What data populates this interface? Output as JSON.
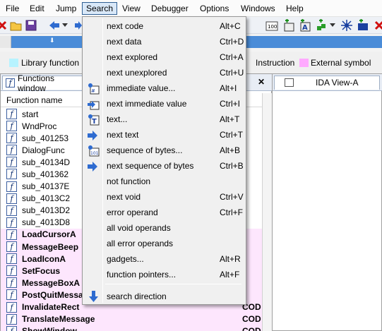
{
  "menubar": {
    "items": [
      "File",
      "Edit",
      "Jump",
      "Search",
      "View",
      "Debugger",
      "Options",
      "Windows",
      "Help"
    ],
    "active": "Search"
  },
  "legend": {
    "items": [
      {
        "label": "Library function",
        "color": "#b7f3ff"
      },
      {
        "label": "Instruction",
        "color": ""
      },
      {
        "label": "External symbol",
        "color": "#ffaaff"
      }
    ]
  },
  "functions_window": {
    "tab_title": "Functions window",
    "column_header": "Function name",
    "rows": [
      {
        "name": "start",
        "library": false,
        "segment": ""
      },
      {
        "name": "WndProc",
        "library": false,
        "segment": ""
      },
      {
        "name": "sub_401253",
        "library": false,
        "segment": ""
      },
      {
        "name": "DialogFunc",
        "library": false,
        "segment": ""
      },
      {
        "name": "sub_40134D",
        "library": false,
        "segment": ""
      },
      {
        "name": "sub_401362",
        "library": false,
        "segment": ""
      },
      {
        "name": "sub_40137E",
        "library": false,
        "segment": ""
      },
      {
        "name": "sub_4013C2",
        "library": false,
        "segment": ""
      },
      {
        "name": "sub_4013D2",
        "library": false,
        "segment": ""
      },
      {
        "name": "sub_4013D8",
        "library": false,
        "segment": ""
      },
      {
        "name": "LoadCursorA",
        "library": true,
        "segment": ""
      },
      {
        "name": "MessageBeep",
        "library": true,
        "segment": ""
      },
      {
        "name": "LoadIconA",
        "library": true,
        "segment": ""
      },
      {
        "name": "SetFocus",
        "library": true,
        "segment": ""
      },
      {
        "name": "MessageBoxA",
        "library": true,
        "segment": ""
      },
      {
        "name": "PostQuitMessag",
        "library": true,
        "segment": ""
      },
      {
        "name": "InvalidateRect",
        "library": true,
        "segment": "COD"
      },
      {
        "name": "TranslateMessage",
        "library": true,
        "segment": "COD"
      },
      {
        "name": "ShowWindow",
        "library": true,
        "segment": "COD"
      }
    ]
  },
  "ida_view": {
    "tab_title": "IDA View-A"
  },
  "search_menu": {
    "items": [
      {
        "label": "next code",
        "shortcut": "Alt+C",
        "icon": ""
      },
      {
        "label": "next data",
        "shortcut": "Ctrl+D",
        "icon": ""
      },
      {
        "label": "next explored",
        "shortcut": "Ctrl+A",
        "icon": ""
      },
      {
        "label": "next unexplored",
        "shortcut": "Ctrl+U",
        "icon": ""
      },
      {
        "label": "immediate value...",
        "shortcut": "Alt+I",
        "icon": "immediate-value-icon"
      },
      {
        "label": "next immediate value",
        "shortcut": "Ctrl+I",
        "icon": "next-immediate-value-icon"
      },
      {
        "label": "text...",
        "shortcut": "Alt+T",
        "icon": "text-search-icon"
      },
      {
        "label": "next text",
        "shortcut": "Ctrl+T",
        "icon": "next-text-icon"
      },
      {
        "label": "sequence of bytes...",
        "shortcut": "Alt+B",
        "icon": "byte-sequence-icon"
      },
      {
        "label": "next sequence of bytes",
        "shortcut": "Ctrl+B",
        "icon": "next-byte-sequence-icon"
      },
      {
        "label": "not function",
        "shortcut": "",
        "icon": ""
      },
      {
        "label": "next void",
        "shortcut": "Ctrl+V",
        "icon": ""
      },
      {
        "label": "error operand",
        "shortcut": "Ctrl+F",
        "icon": ""
      },
      {
        "label": "all void operands",
        "shortcut": "",
        "icon": ""
      },
      {
        "label": "all error operands",
        "shortcut": "",
        "icon": ""
      },
      {
        "label": "gadgets...",
        "shortcut": "Alt+R",
        "icon": ""
      },
      {
        "label": "function pointers...",
        "shortcut": "Alt+F",
        "icon": ""
      },
      {
        "label": "search direction",
        "shortcut": "",
        "icon": "search-direction-arrow-icon"
      }
    ]
  },
  "colors": {
    "library_row": "#fde6fd",
    "menu_bg": "#f0f0f0",
    "nav_band": "#4a8cd8"
  }
}
